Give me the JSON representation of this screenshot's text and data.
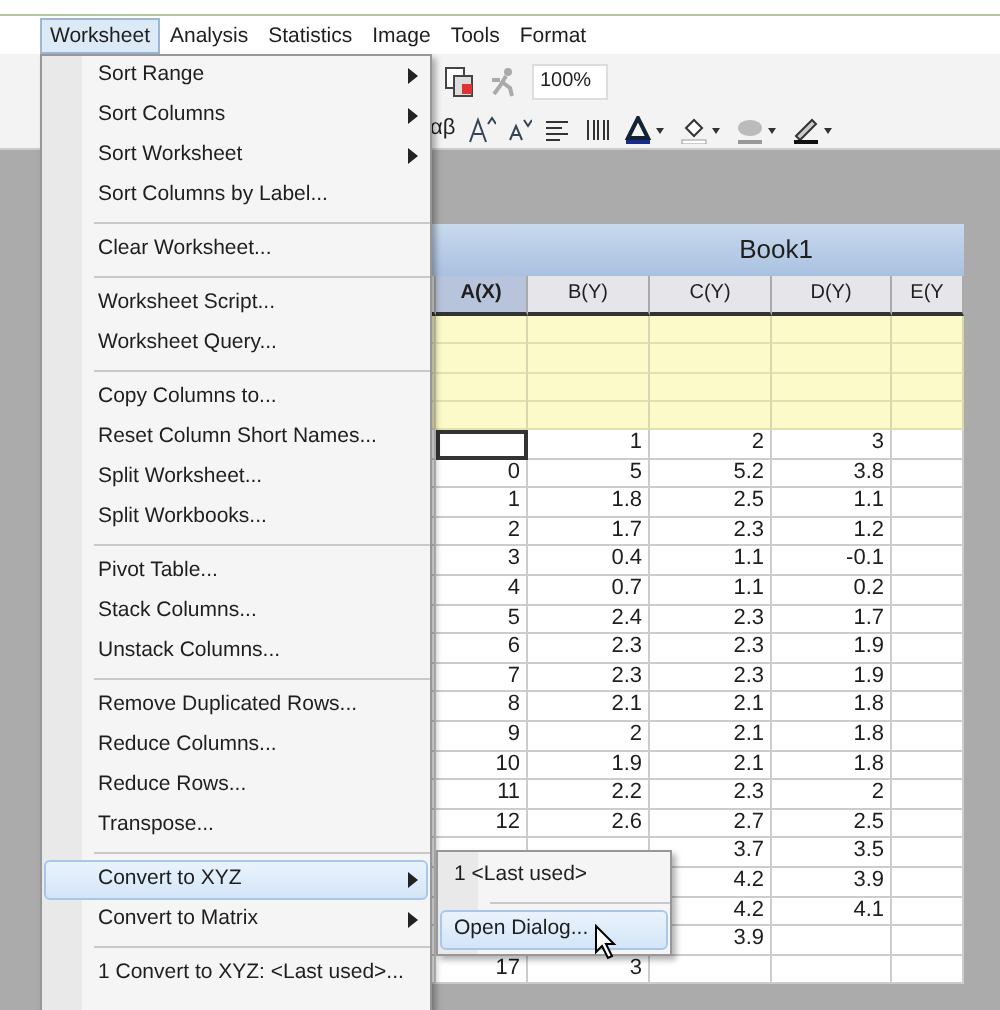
{
  "menu_bar": [
    {
      "label": "Worksheet",
      "selected": true
    },
    {
      "label": "Analysis",
      "selected": false
    },
    {
      "label": "Statistics",
      "selected": false
    },
    {
      "label": "Image",
      "selected": false
    },
    {
      "label": "Tools",
      "selected": false
    },
    {
      "label": "Format",
      "selected": false
    }
  ],
  "toolbar": {
    "zoom": "100%",
    "greek_button": "αβ"
  },
  "worksheet_menu": {
    "groups": [
      [
        {
          "label": "Sort Range",
          "submenu": true,
          "selected": false
        },
        {
          "label": "Sort Columns",
          "submenu": true,
          "selected": false
        },
        {
          "label": "Sort Worksheet",
          "submenu": true,
          "selected": false
        },
        {
          "label": "Sort Columns by Label...",
          "submenu": false,
          "selected": false
        }
      ],
      [
        {
          "label": "Clear Worksheet...",
          "submenu": false,
          "selected": false
        }
      ],
      [
        {
          "label": "Worksheet Script...",
          "submenu": false,
          "selected": false
        },
        {
          "label": "Worksheet Query...",
          "submenu": false,
          "selected": false
        }
      ],
      [
        {
          "label": "Copy Columns to...",
          "submenu": false,
          "selected": false
        },
        {
          "label": "Reset Column Short Names...",
          "submenu": false,
          "selected": false
        },
        {
          "label": "Split Worksheet...",
          "submenu": false,
          "selected": false
        },
        {
          "label": "Split Workbooks...",
          "submenu": false,
          "selected": false
        }
      ],
      [
        {
          "label": "Pivot Table...",
          "submenu": false,
          "selected": false
        },
        {
          "label": "Stack Columns...",
          "submenu": false,
          "selected": false
        },
        {
          "label": "Unstack Columns...",
          "submenu": false,
          "selected": false
        }
      ],
      [
        {
          "label": "Remove Duplicated Rows...",
          "submenu": false,
          "selected": false
        },
        {
          "label": "Reduce Columns...",
          "submenu": false,
          "selected": false
        },
        {
          "label": "Reduce Rows...",
          "submenu": false,
          "selected": false
        },
        {
          "label": "Transpose...",
          "submenu": false,
          "selected": false
        }
      ],
      [
        {
          "label": "Convert to XYZ",
          "submenu": true,
          "selected": true
        },
        {
          "label": "Convert to Matrix",
          "submenu": true,
          "selected": false
        }
      ],
      [
        {
          "label": "1 Convert to XYZ: <Last used>...",
          "submenu": false,
          "selected": false
        }
      ]
    ]
  },
  "submenu": {
    "groups": [
      [
        {
          "label": "1 <Last used>",
          "selected": false
        }
      ],
      [
        {
          "label": "Open Dialog...",
          "selected": true
        }
      ]
    ]
  },
  "workbook": {
    "title": "Book1",
    "columns": [
      {
        "label": "A(X)",
        "selected": true
      },
      {
        "label": "B(Y)",
        "selected": false
      },
      {
        "label": "C(Y)",
        "selected": false
      },
      {
        "label": "D(Y)",
        "selected": false
      },
      {
        "label": "E(Y",
        "selected": false
      }
    ],
    "rows": [
      [
        null,
        "1",
        "2",
        "3",
        null
      ],
      [
        "0",
        "5",
        "5.2",
        "3.8",
        null
      ],
      [
        "1",
        "1.8",
        "2.5",
        "1.1",
        null
      ],
      [
        "2",
        "1.7",
        "2.3",
        "1.2",
        null
      ],
      [
        "3",
        "0.4",
        "1.1",
        "-0.1",
        null
      ],
      [
        "4",
        "0.7",
        "1.1",
        "0.2",
        null
      ],
      [
        "5",
        "2.4",
        "2.3",
        "1.7",
        null
      ],
      [
        "6",
        "2.3",
        "2.3",
        "1.9",
        null
      ],
      [
        "7",
        "2.3",
        "2.3",
        "1.9",
        null
      ],
      [
        "8",
        "2.1",
        "2.1",
        "1.8",
        null
      ],
      [
        "9",
        "2",
        "2.1",
        "1.8",
        null
      ],
      [
        "10",
        "1.9",
        "2.1",
        "1.8",
        null
      ],
      [
        "11",
        "2.2",
        "2.3",
        "2",
        null
      ],
      [
        "12",
        "2.6",
        "2.7",
        "2.5",
        null
      ],
      [
        null,
        null,
        "3.7",
        "3.5",
        null
      ],
      [
        null,
        null,
        "4.2",
        "3.9",
        null
      ],
      [
        null,
        null,
        "4.2",
        "4.1",
        null
      ],
      [
        null,
        null,
        "3.9",
        null,
        null
      ],
      [
        "17",
        "3",
        null,
        null,
        null
      ]
    ]
  }
}
